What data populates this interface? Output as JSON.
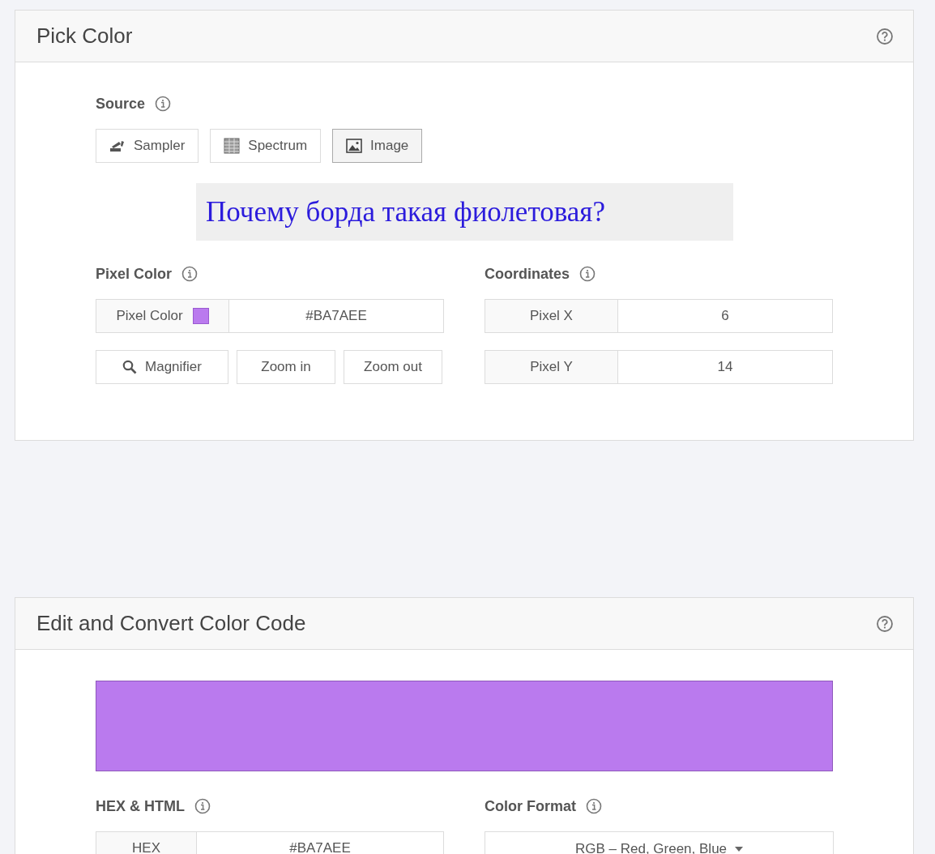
{
  "pick_color": {
    "title": "Pick Color",
    "source": {
      "label": "Source",
      "buttons": [
        {
          "kind": "sampler",
          "label": "Sampler",
          "selected": false
        },
        {
          "kind": "spectrum",
          "label": "Spectrum",
          "selected": false
        },
        {
          "kind": "image",
          "label": "Image",
          "selected": true
        }
      ]
    },
    "image_text": "Почему борда такая фиолетовая?",
    "pixel_color": {
      "label": "Pixel Color",
      "field_label": "Pixel Color",
      "color": "#ba7aee",
      "value": "#BA7AEE",
      "buttons": [
        {
          "kind": "magnifier",
          "label": "Magnifier"
        },
        {
          "kind": "plain",
          "label": "Zoom in"
        },
        {
          "kind": "plain",
          "label": "Zoom out"
        }
      ]
    },
    "coordinates": {
      "label": "Coordinates",
      "rows": [
        {
          "label": "Pixel X",
          "value": "6"
        },
        {
          "label": "Pixel Y",
          "value": "14"
        }
      ]
    }
  },
  "edit_convert": {
    "title": "Edit and Convert Color Code",
    "color": "#ba7aee",
    "hex": {
      "label": "HEX & HTML",
      "field_label": "HEX",
      "value": "#BA7AEE"
    },
    "format": {
      "label": "Color Format",
      "value": "RGB – Red, Green, Blue"
    }
  }
}
